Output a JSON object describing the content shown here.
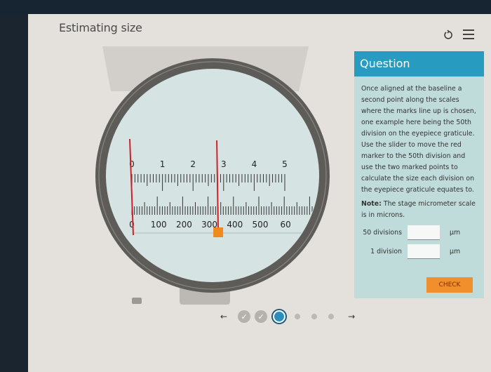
{
  "header": {
    "title": "Estimating size",
    "reset_icon": "reset-icon",
    "menu_icon": "hamburger-menu-icon"
  },
  "microscope": {
    "eyepiece_scale_labels": [
      "0",
      "1",
      "2",
      "3",
      "4",
      "5"
    ],
    "stage_scale_labels": [
      "0",
      "100",
      "200",
      "300",
      "400",
      "500",
      "60"
    ],
    "slider_value_microns": 340,
    "colors": {
      "marker": "#d2202a",
      "slider": "#f08a1c",
      "field": "#d5e4e2",
      "rim": "#5c5a57"
    }
  },
  "question": {
    "heading": "Question",
    "body": "Once aligned at the baseline a second point along the scales where the marks line up is chosen, one example here being the 50th division on the eyepiece graticule. Use the slider to move the red marker to the 50th division and use the two marked points to calculate the size each division on the eyepiece graticule equates to.",
    "note_label": "Note:",
    "note_text": " The stage micrometer scale is in microns.",
    "fields": [
      {
        "label": "50 divisions",
        "value": "",
        "unit": "µm"
      },
      {
        "label": "1 division",
        "value": "",
        "unit": "µm"
      }
    ],
    "check_label": "CHECK"
  },
  "navigation": {
    "prev_icon": "←",
    "next_icon": "→",
    "steps": [
      "done",
      "done",
      "current",
      "todo",
      "todo",
      "todo"
    ],
    "check_glyph": "✓"
  }
}
